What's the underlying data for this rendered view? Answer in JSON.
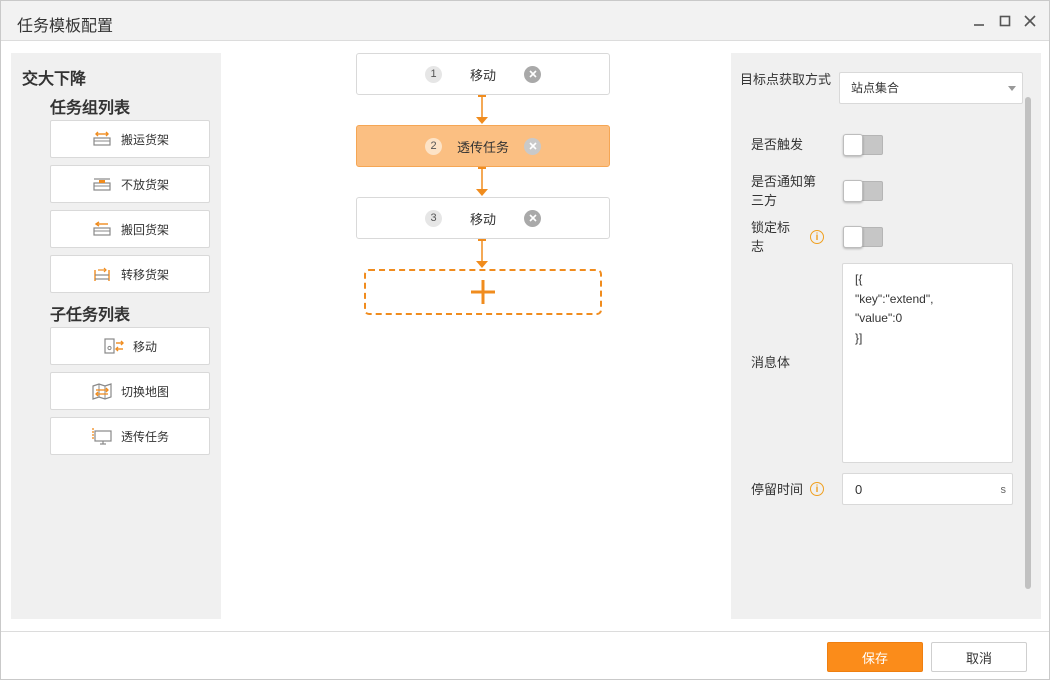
{
  "window": {
    "title": "任务模板配置"
  },
  "left": {
    "root_label": "交大下降",
    "group_title": "任务组列表",
    "group_items": [
      {
        "label": "搬运货架",
        "icon": "transport-shelf-icon"
      },
      {
        "label": "不放货架",
        "icon": "no-shelf-icon"
      },
      {
        "label": "搬回货架",
        "icon": "return-shelf-icon"
      },
      {
        "label": "转移货架",
        "icon": "transfer-shelf-icon"
      }
    ],
    "sub_title": "子任务列表",
    "sub_items": [
      {
        "label": "移动",
        "icon": "move-icon"
      },
      {
        "label": "切换地图",
        "icon": "switch-map-icon"
      },
      {
        "label": "透传任务",
        "icon": "passthrough-task-icon"
      }
    ]
  },
  "flow": {
    "nodes": [
      {
        "num": "1",
        "label": "移动",
        "active": false
      },
      {
        "num": "2",
        "label": "透传任务",
        "active": true
      },
      {
        "num": "3",
        "label": "移动",
        "active": false
      }
    ],
    "accent_color": "#f08c1e"
  },
  "right": {
    "target_label": "目标点获取方式",
    "target_value": "站点集合",
    "trigger_label": "是否触发",
    "trigger_on": false,
    "notify_label": "是否通知第三方",
    "notify_on": false,
    "lock_label": "锁定标志",
    "lock_on": false,
    "message_label": "消息体",
    "message_value": "[{\n\"key\":\"extend\",\n\"value\":0\n}]",
    "stay_label": "停留时间",
    "stay_value": "0",
    "stay_unit": "s"
  },
  "footer": {
    "save_label": "保存",
    "cancel_label": "取消"
  }
}
